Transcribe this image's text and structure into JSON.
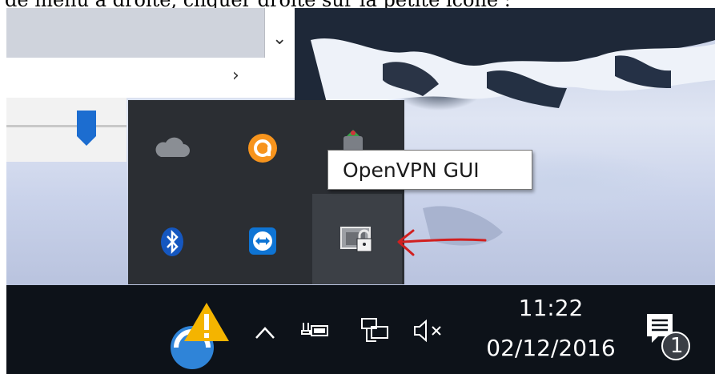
{
  "caption": {
    "text": "de menu à droite, cliquer droite sur la petite icône :"
  },
  "tooltip": {
    "text": "OpenVPN GUI"
  },
  "tray_overflow": {
    "icons": [
      "onedrive-icon",
      "avast-icon",
      "app-icon",
      "bluetooth-icon",
      "teamviewer-icon",
      "openvpn-icon"
    ]
  },
  "taskbar": {
    "time": "11:22",
    "date": "02/12/2016",
    "notification_count": "1"
  },
  "colors": {
    "taskbar": "#0d1219",
    "tray_popup": "#2b2e33",
    "tray_selected": "#3c4046",
    "avast_orange": "#f7941d",
    "teamviewer_blue": "#0e74d4",
    "slider_thumb": "#1c6dd0",
    "arrow_red": "#d12020"
  }
}
